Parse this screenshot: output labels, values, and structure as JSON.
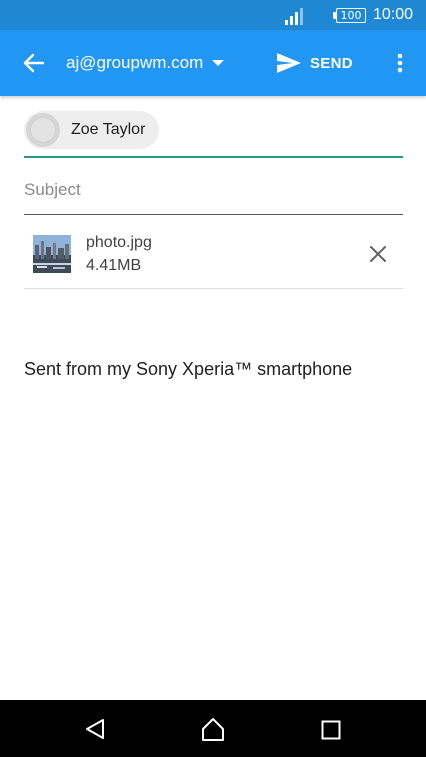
{
  "status_bar": {
    "battery_level": "100",
    "time": "10:00",
    "icons": [
      "signal-icon",
      "battery-icon"
    ]
  },
  "header": {
    "account_email": "aj@groupwm.com",
    "send_label": "SEND",
    "icons": [
      "back-arrow-icon",
      "dropdown-icon",
      "send-icon",
      "overflow-menu-icon"
    ]
  },
  "compose": {
    "recipients": [
      {
        "name": "Zoe Taylor"
      }
    ],
    "subject": {
      "value": "",
      "placeholder": "Subject"
    },
    "attachments": [
      {
        "name": "photo.jpg",
        "size": "4.41MB"
      }
    ],
    "body": "Sent from my Sony Xperia™ smartphone"
  },
  "nav_bar": {
    "icons": [
      "nav-back-icon",
      "nav-home-icon",
      "nav-recents-icon"
    ]
  },
  "colors": {
    "status_bar": "#1e88d4",
    "app_bar": "#2196f3",
    "recipient_underline": "#279a85",
    "chip_background": "#eeeeee"
  }
}
